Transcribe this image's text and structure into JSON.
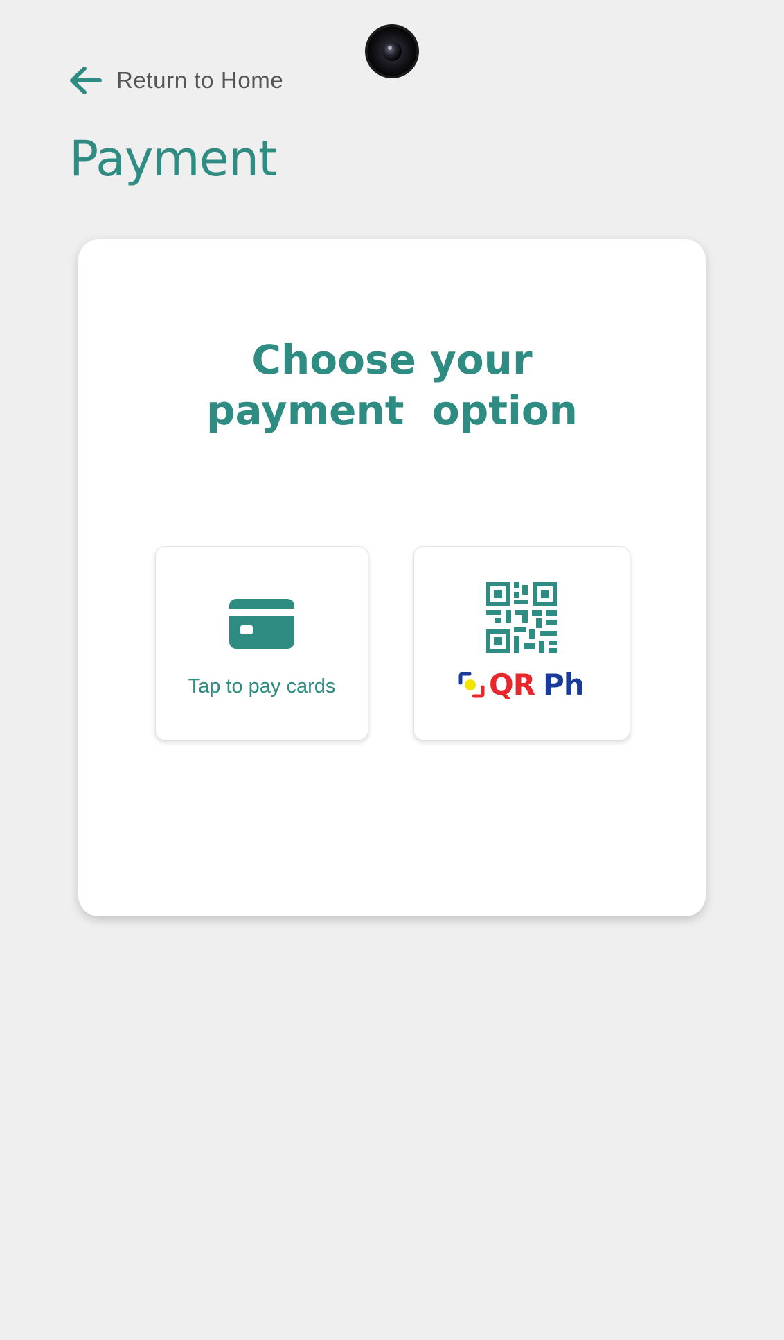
{
  "header": {
    "back_label": "Return to Home",
    "page_title": "Payment"
  },
  "card": {
    "heading_line1": "Choose your",
    "heading_line2": "payment  option"
  },
  "options": {
    "card_label": "Tap to pay cards",
    "qr_logo_left": "QR",
    "qr_logo_right": "Ph"
  },
  "colors": {
    "background": "#efefef",
    "accent": "#2f8c82",
    "qr_red": "#e8262b",
    "qr_blue": "#1a3a9a",
    "qr_yellow": "#f5e400"
  },
  "icons": {
    "back": "arrow-left-icon",
    "card": "credit-card-icon",
    "qr": "qr-code-icon",
    "logo": "qrph-logo"
  }
}
